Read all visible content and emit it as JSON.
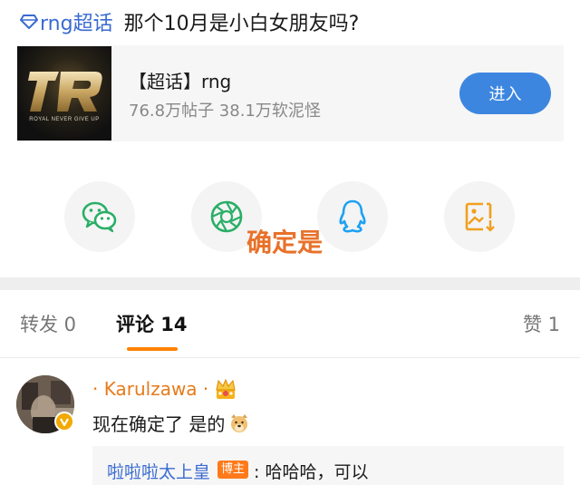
{
  "post": {
    "topic_link": "rng超话",
    "title": "那个10月是小白女朋友吗?"
  },
  "topic_card": {
    "logo_caption": "ROYAL NEVER GIVE UP",
    "name": "【超话】rng",
    "stats": "76.8万帖子 38.1万软泥怪",
    "enter_label": "进入"
  },
  "share": {
    "items": [
      {
        "icon": "wechat-icon",
        "color": "#2aae67"
      },
      {
        "icon": "moments-icon",
        "color": "#2aae67"
      },
      {
        "icon": "qq-icon",
        "color": "#1da1f2"
      },
      {
        "icon": "save-image-icon",
        "color": "#f0a020"
      }
    ],
    "overlay_text": "确定是"
  },
  "tabs": {
    "repost": "转发 0",
    "comment": "评论 14",
    "like": "赞 1",
    "active": "comment",
    "accent": "#ff8200"
  },
  "comment": {
    "username": "· Karulzawa ·",
    "text": "现在确定了 是的",
    "reply": {
      "user": "啦啦啦太上皇",
      "badge": "博主",
      "text": ": 哈哈哈，可以"
    }
  }
}
